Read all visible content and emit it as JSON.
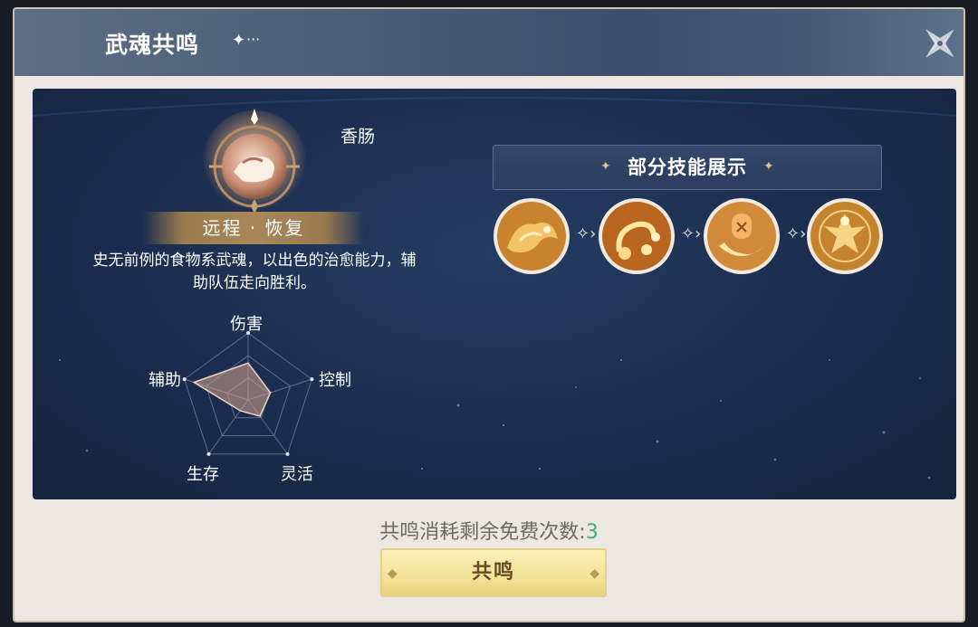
{
  "dialog": {
    "title": "武魂共鸣",
    "title_deco": "✦",
    "title_more": "···",
    "close_icon": "close-x-icon"
  },
  "hero": {
    "name": "香肠",
    "role": "远程 · 恢复",
    "description": "史无前例的食物系武魂，以出色的治愈能力，辅助队伍走向胜利。",
    "icon": "sausage-spirit-emblem-icon"
  },
  "radar": {
    "labels": {
      "damage": "伤害",
      "control": "控制",
      "agility": "灵活",
      "survival": "生存",
      "support": "辅助"
    },
    "values": {
      "damage": 0.55,
      "control": 0.35,
      "agility": 0.3,
      "survival": 0.2,
      "support": 0.85
    },
    "accent": "#d6a48c"
  },
  "skills": {
    "title": "部分技能展示",
    "deco": "✦",
    "icons": [
      "skill-flame-beast-icon",
      "skill-swirl-fireball-icon",
      "skill-rune-vortex-icon",
      "skill-golden-guardian-icon"
    ],
    "arrow": "✧›"
  },
  "footer": {
    "cost_label": "共鸣消耗剩余免费次数:",
    "cost_value": "3",
    "resonate_label": "共鸣",
    "cost_value_color": "#3cae7e"
  }
}
